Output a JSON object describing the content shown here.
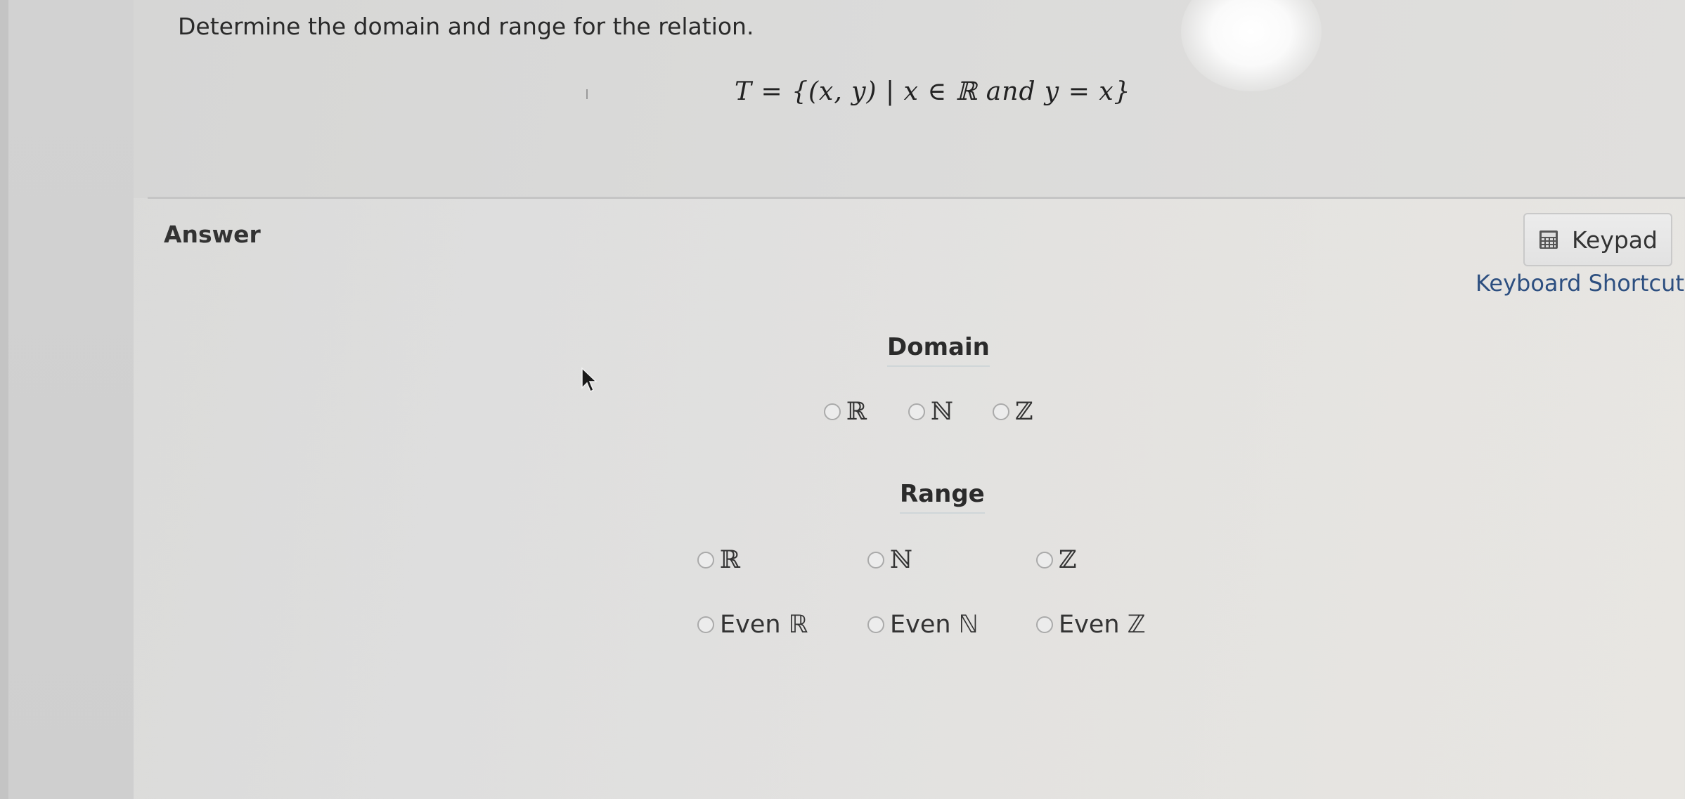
{
  "question": {
    "prompt": "Determine the domain and range for the relation.",
    "formula": "T = {(x, y) | x ∈ ℝ and y = x}"
  },
  "answer": {
    "label": "Answer",
    "keypad_label": "Keypad",
    "shortcuts_label": "Keyboard Shortcuts"
  },
  "domain": {
    "heading": "Domain",
    "options": [
      "ℝ",
      "ℕ",
      "ℤ"
    ]
  },
  "range": {
    "heading": "Range",
    "options": [
      "ℝ",
      "ℕ",
      "ℤ",
      "Even ℝ",
      "Even ℕ",
      "Even ℤ"
    ]
  },
  "icons": {
    "keypad": "calculator-icon",
    "pointer": "mouse-cursor-icon"
  },
  "colors": {
    "link": "#2d4f80",
    "radio_border": "#aaaaaa"
  }
}
